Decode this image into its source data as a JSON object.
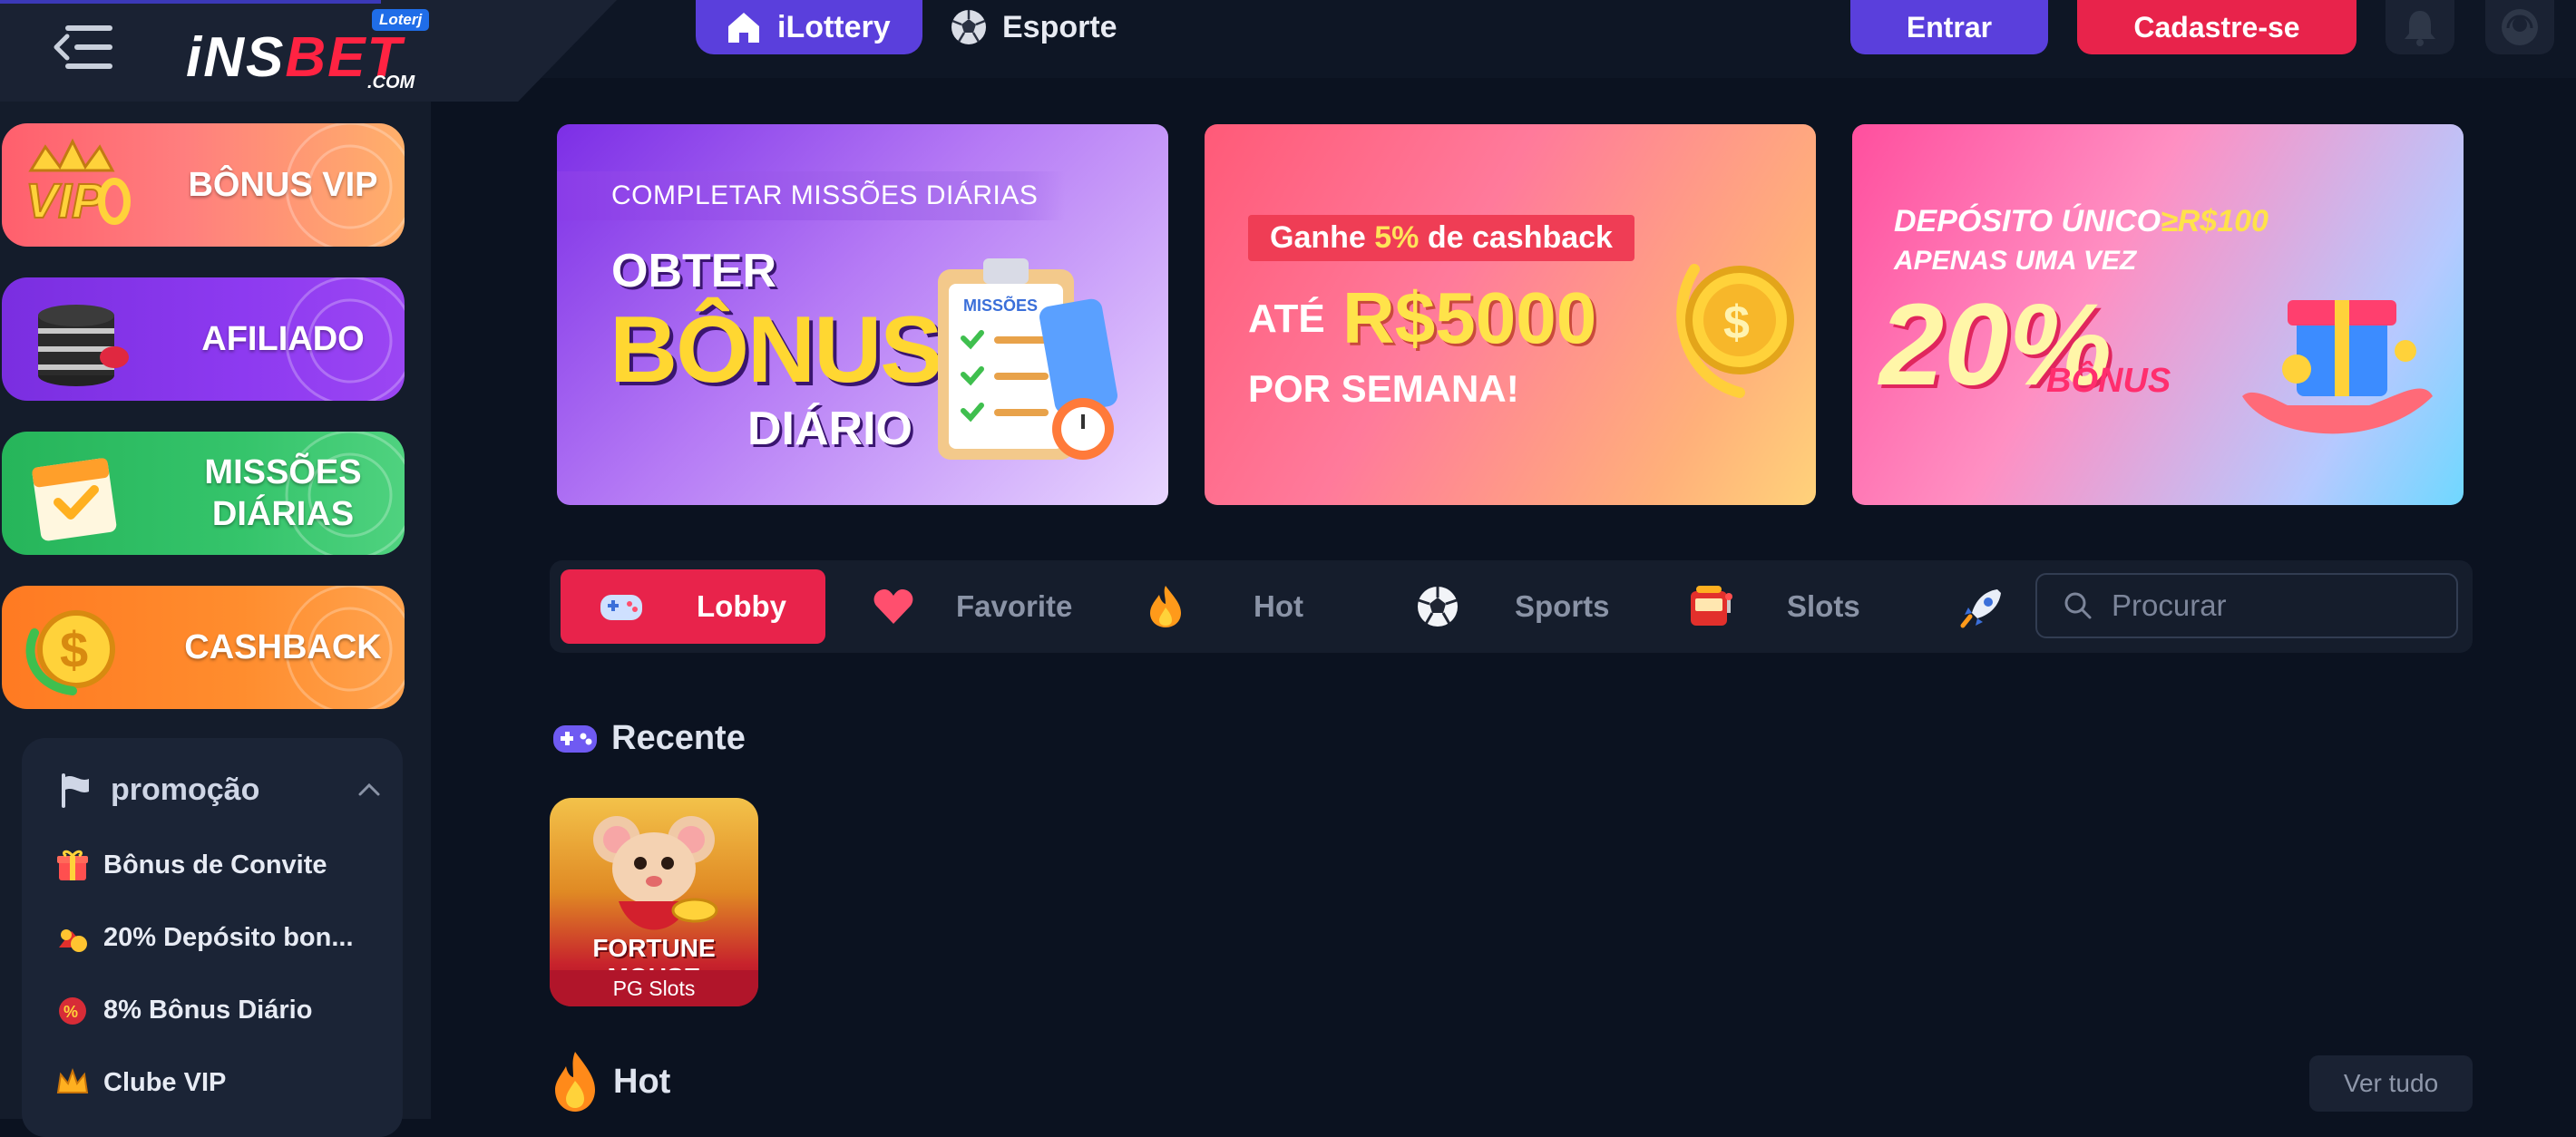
{
  "header": {
    "logo": {
      "word_white": "iNS",
      "word_red": "BET",
      "suffix": ".COM",
      "badge": "Loterj"
    },
    "nav": [
      {
        "label": "iLottery",
        "icon": "home-icon",
        "active": true
      },
      {
        "label": "Esporte",
        "icon": "soccer-ball-icon",
        "active": false
      }
    ],
    "login_label": "Entrar",
    "register_label": "Cadastre-se",
    "colors": {
      "accent": "#5a3fdc",
      "register": "#e8234b",
      "background": "#0b1220"
    }
  },
  "sidebar": {
    "cards": [
      {
        "label": "BÔNUS VIP",
        "icon": "vip-crown-icon"
      },
      {
        "label": "AFILIADO",
        "icon": "chip-stack-icon"
      },
      {
        "label": "MISSÕES DIÁRIAS",
        "icon": "calendar-check-icon"
      },
      {
        "label": "CASHBACK",
        "icon": "dollar-coin-icon"
      }
    ],
    "promo": {
      "title": "promoção",
      "items": [
        {
          "label": "Bônus de Convite",
          "icon": "gift-icon"
        },
        {
          "label": "20% Depósito bon...",
          "icon": "gift-bag-icon"
        },
        {
          "label": "8% Bônus Diário",
          "icon": "percent-badge-icon"
        },
        {
          "label": "Clube VIP",
          "icon": "crown-icon"
        }
      ]
    }
  },
  "banners": [
    {
      "strip": "COMPLETAR MISSÕES DIÁRIAS",
      "line1": "OBTER",
      "line2": "BÔNUS",
      "line3": "DIÁRIO",
      "board_label": "MISSÕES"
    },
    {
      "pill_prefix": "Ganhe ",
      "pill_highlight": "5%",
      "pill_suffix": " de cashback",
      "ate": "ATÉ",
      "amount": "R$5000",
      "per_week": "POR SEMANA!"
    },
    {
      "deposit_prefix": "DEPÓSITO ÚNICO",
      "deposit_value": "≥R$100",
      "once": "APENAS UMA VEZ",
      "percent": "20%",
      "bonus": "BÔNUS"
    }
  ],
  "game_tabs": [
    {
      "label": "Lobby",
      "icon": "gamepad-icon",
      "active": true
    },
    {
      "label": "Favorite",
      "icon": "heart-icon",
      "active": false
    },
    {
      "label": "Hot",
      "icon": "fire-icon",
      "active": false
    },
    {
      "label": "Sports",
      "icon": "soccer-ball-icon",
      "active": false
    },
    {
      "label": "Slots",
      "icon": "slot-machine-icon",
      "active": false
    },
    {
      "label": "",
      "icon": "rocket-icon",
      "active": false
    }
  ],
  "search": {
    "placeholder": "Procurar"
  },
  "recent": {
    "title": "Recente",
    "games": [
      {
        "name": "FORTUNE MOUSE",
        "provider": "PG Slots"
      }
    ]
  },
  "hot": {
    "title": "Hot",
    "see_all": "Ver tudo"
  }
}
